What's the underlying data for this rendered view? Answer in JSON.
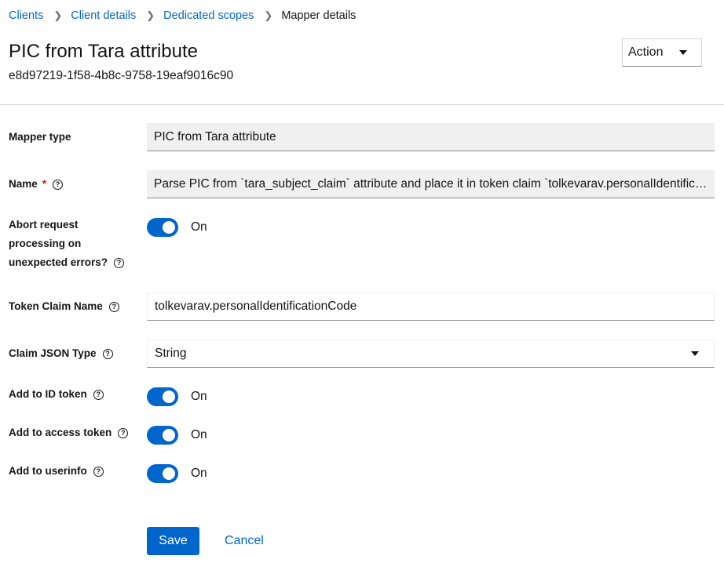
{
  "breadcrumb": {
    "items": [
      "Clients",
      "Client details",
      "Dedicated scopes"
    ],
    "current": "Mapper details"
  },
  "header": {
    "title": "PIC from Tara attribute",
    "subtitle": "e8d97219-1f58-4b8c-9758-19eaf9016c90",
    "action_label": "Action"
  },
  "form": {
    "mapper_type": {
      "label": "Mapper type",
      "value": "PIC from Tara attribute"
    },
    "name": {
      "label": "Name",
      "required_mark": "*",
      "value": "Parse PIC from `tara_subject_claim` attribute and place it in token claim `tolkevarav.personalIdentificationCode`"
    },
    "abort": {
      "label_lines": [
        "Abort request",
        "processing on",
        "unexpected errors?"
      ],
      "state": "On"
    },
    "token_claim_name": {
      "label": "Token Claim Name",
      "value": "tolkevarav.personalIdentificationCode"
    },
    "claim_json_type": {
      "label": "Claim JSON Type",
      "value": "String"
    },
    "add_id_token": {
      "label": "Add to ID token",
      "state": "On"
    },
    "add_access_token": {
      "label": "Add to access token",
      "state": "On"
    },
    "add_userinfo": {
      "label": "Add to userinfo",
      "state": "On"
    }
  },
  "help_icon_glyph": "?",
  "buttons": {
    "save": "Save",
    "cancel": "Cancel"
  },
  "colors": {
    "primary": "#0066cc",
    "required": "#c9190b",
    "readonly_bg": "#f0f0f0"
  }
}
